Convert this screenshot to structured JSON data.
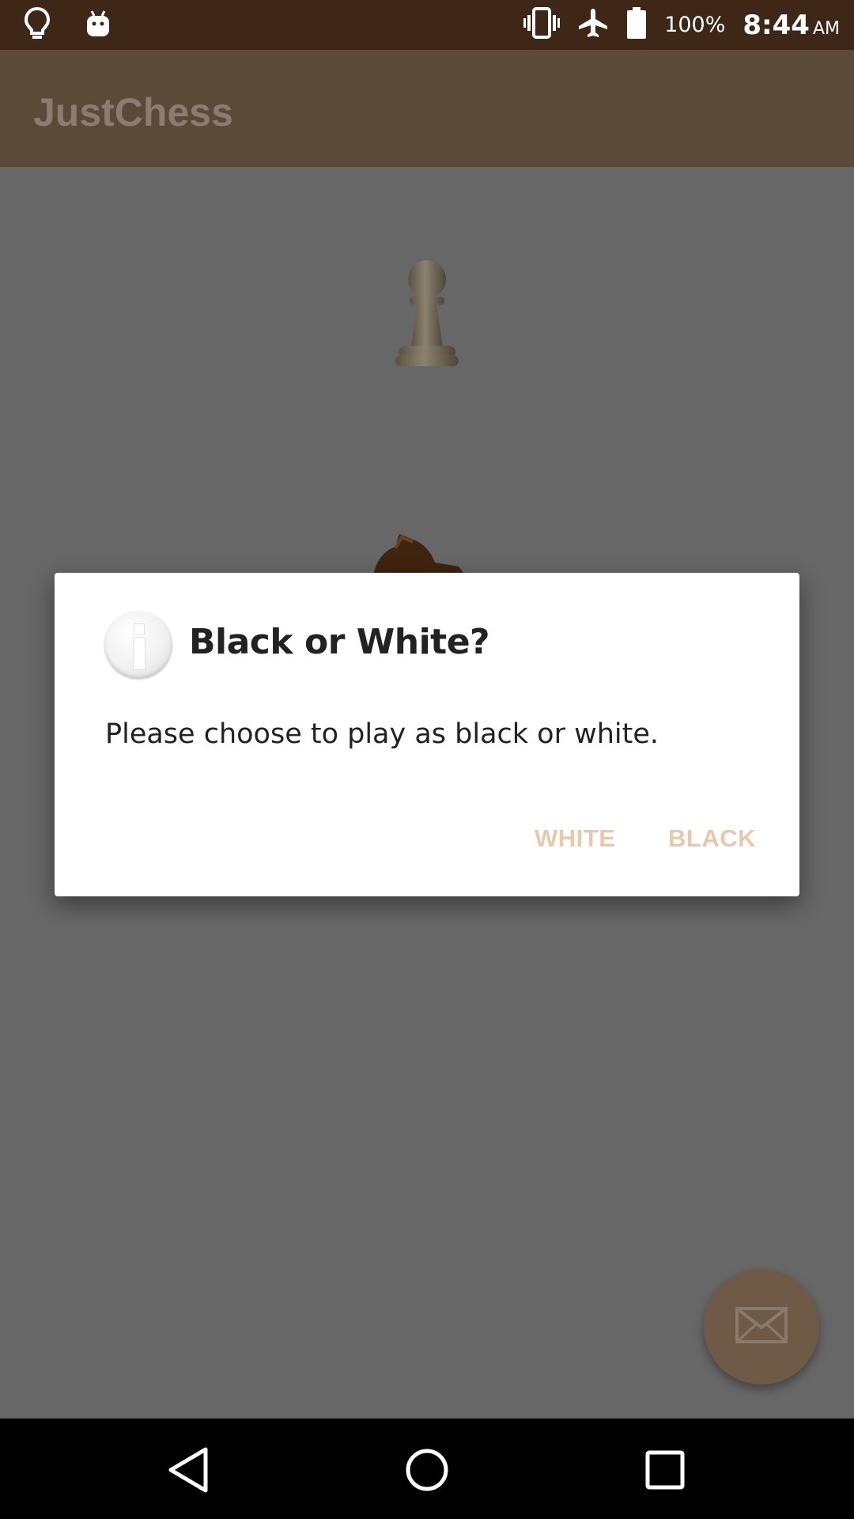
{
  "status_bar": {
    "battery_percent": "100%",
    "time": "8:44",
    "ampm": "AM",
    "icons": [
      "lightbulb-icon",
      "android-icon",
      "vibrate-icon",
      "airplane-icon",
      "battery-icon"
    ]
  },
  "app_bar": {
    "title": "JustChess"
  },
  "dialog": {
    "icon": "info-icon",
    "title": "Black or White?",
    "message": "Please choose to play as black or white.",
    "buttons": {
      "white": "WHITE",
      "black": "BLACK"
    }
  },
  "fab": {
    "icon": "mail-icon"
  },
  "nav_bar": {
    "icons": [
      "back-icon",
      "home-icon",
      "recents-icon"
    ]
  },
  "colors": {
    "status_bar": "#3f2717",
    "app_bar": "#5c4a38",
    "accent_button_text": "#e6c9ae",
    "scrim": "#676767"
  }
}
